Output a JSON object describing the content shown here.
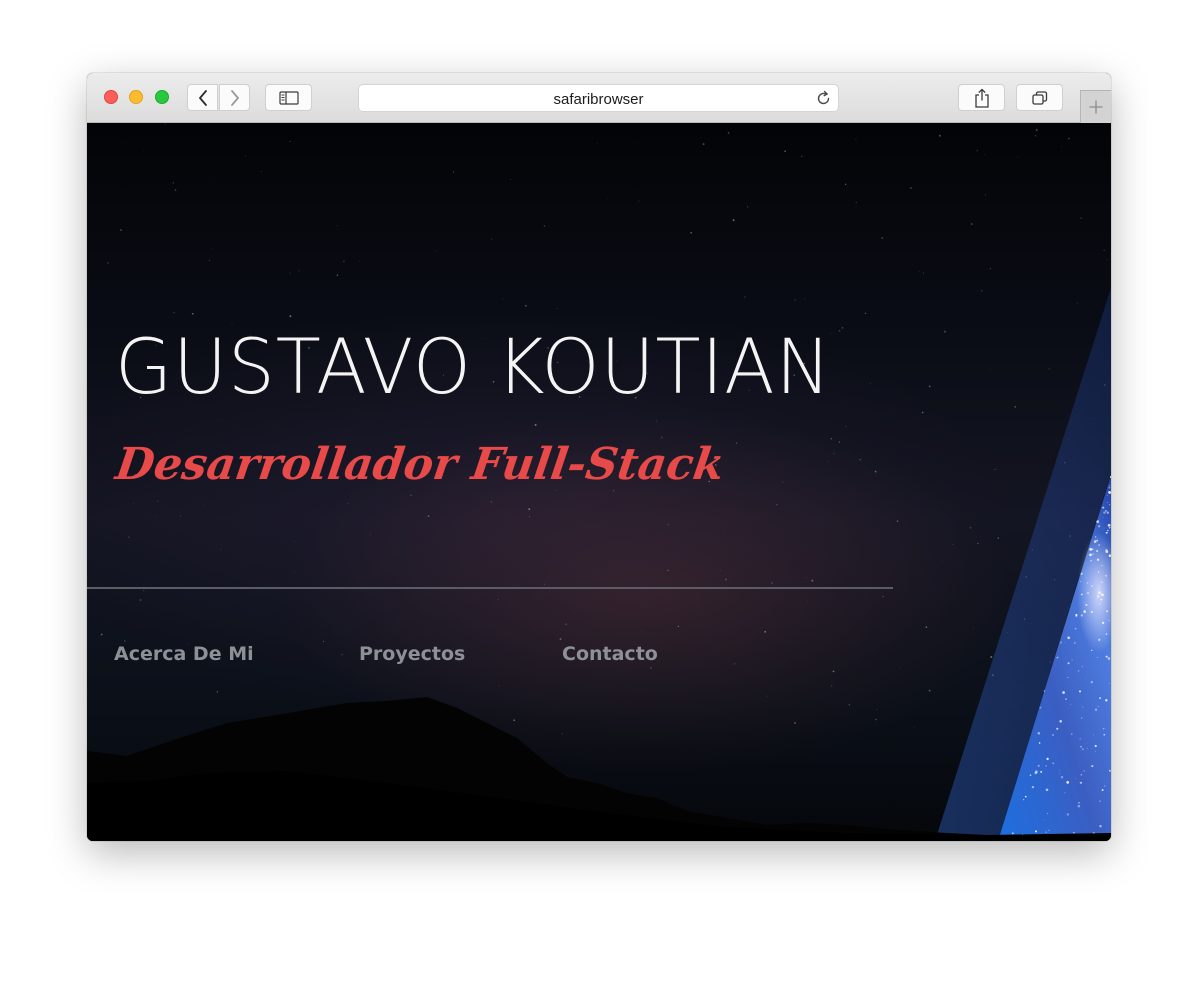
{
  "browser": {
    "address_text": "safaribrowser"
  },
  "hero": {
    "title": "GUSTAVO KOUTIAN",
    "subtitle": "Desarrollador Full-Stack"
  },
  "nav": {
    "items": [
      {
        "label": "Acerca De Mi"
      },
      {
        "label": "Proyectos"
      },
      {
        "label": "Contacto"
      }
    ]
  },
  "colors": {
    "subtitle_accent": "#e84a4a",
    "nav_text": "#8e9097",
    "title_text": "#f4f4f4",
    "traffic_red": "#fc5f57",
    "traffic_yellow": "#fdbc2e",
    "traffic_green": "#28c840"
  },
  "icons": {
    "back": "chevron-left-icon",
    "forward": "chevron-right-icon",
    "sidebar": "sidebar-icon",
    "reload": "reload-icon",
    "share": "share-icon",
    "tabs": "tabs-overview-icon",
    "new_tab": "plus-icon"
  }
}
